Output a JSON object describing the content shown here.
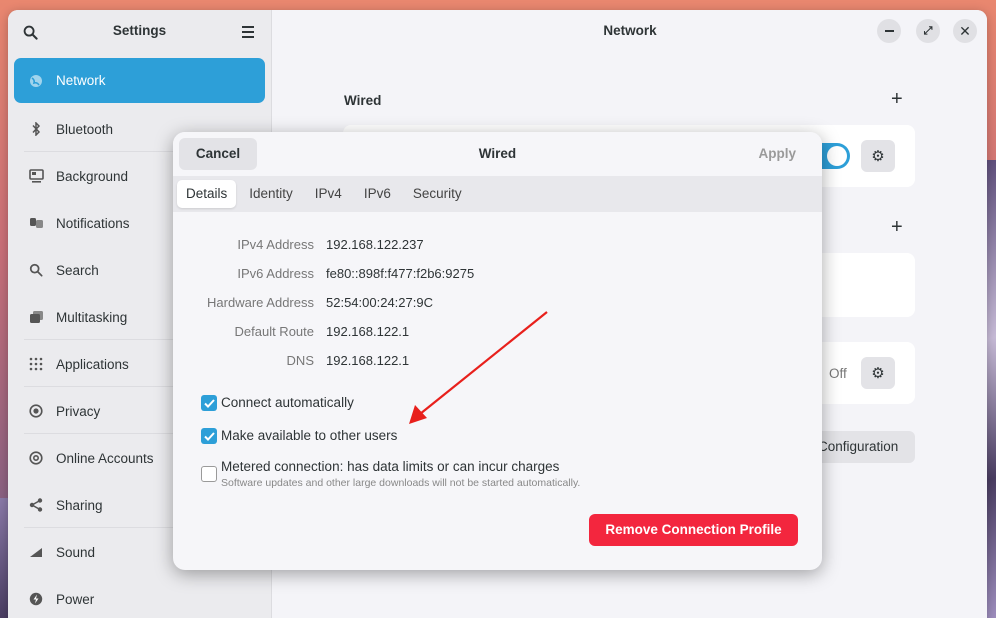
{
  "sidebar": {
    "title": "Settings",
    "items": [
      {
        "label": "Network",
        "icon": "globe-icon"
      },
      {
        "label": "Bluetooth",
        "icon": "bluetooth-icon"
      },
      {
        "label": "Background",
        "icon": "monitor-icon"
      },
      {
        "label": "Notifications",
        "icon": "bell-icon"
      },
      {
        "label": "Search",
        "icon": "search-icon"
      },
      {
        "label": "Multitasking",
        "icon": "multitasking-icon"
      },
      {
        "label": "Applications",
        "icon": "grid-icon"
      },
      {
        "label": "Privacy",
        "icon": "privacy-icon"
      },
      {
        "label": "Online Accounts",
        "icon": "at-icon"
      },
      {
        "label": "Sharing",
        "icon": "share-icon"
      },
      {
        "label": "Sound",
        "icon": "sound-icon"
      },
      {
        "label": "Power",
        "icon": "power-icon"
      }
    ]
  },
  "main": {
    "title": "Network",
    "wired_section": "Wired",
    "off_label": "Off",
    "config_button": "Configuration"
  },
  "dialog": {
    "cancel": "Cancel",
    "title": "Wired",
    "apply": "Apply",
    "tabs": [
      "Details",
      "Identity",
      "IPv4",
      "IPv6",
      "Security"
    ],
    "details": [
      {
        "label": "IPv4 Address",
        "value": "192.168.122.237"
      },
      {
        "label": "IPv6 Address",
        "value": "fe80::898f:f477:f2b6:9275"
      },
      {
        "label": "Hardware Address",
        "value": "52:54:00:24:27:9C"
      },
      {
        "label": "Default Route",
        "value": "192.168.122.1"
      },
      {
        "label": "DNS",
        "value": "192.168.122.1"
      }
    ],
    "connect_auto": "Connect automatically",
    "available_users": "Make available to other users",
    "metered": "Metered connection: has data limits or can incur charges",
    "metered_sub": "Software updates and other large downloads will not be started automatically.",
    "remove": "Remove Connection Profile"
  },
  "colors": {
    "accent": "#2d9fd8",
    "destructive": "#f3263e",
    "annotation_arrow": "#e8201c"
  }
}
